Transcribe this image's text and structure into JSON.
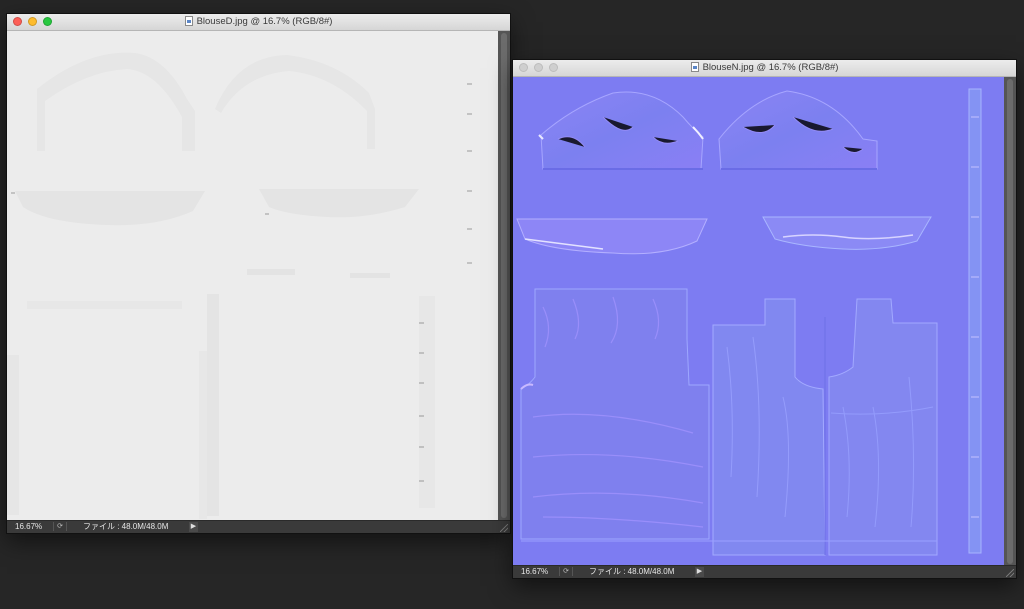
{
  "windows": [
    {
      "title": "BlouseD.jpg @ 16.7% (RGB/8#)",
      "zoom": "16.67%",
      "file_info": "ファイル : 48.0M/48.0M",
      "active": true
    },
    {
      "title": "BlouseN.jpg @ 16.7% (RGB/8#)",
      "zoom": "16.67%",
      "file_info": "ファイル : 48.0M/48.0M",
      "active": false
    }
  ],
  "colors": {
    "desktop": "#262626",
    "diffuse_bg": "#ececec",
    "normal_bg": "#7d7cf2",
    "traffic_red": "#fd5f57",
    "traffic_yellow": "#febc2e",
    "traffic_green": "#28c840"
  },
  "icons": [
    "document-icon",
    "close-icon",
    "minimize-icon",
    "zoom-icon",
    "status-menu-icon",
    "play-arrow-icon",
    "resize-grip-icon"
  ]
}
